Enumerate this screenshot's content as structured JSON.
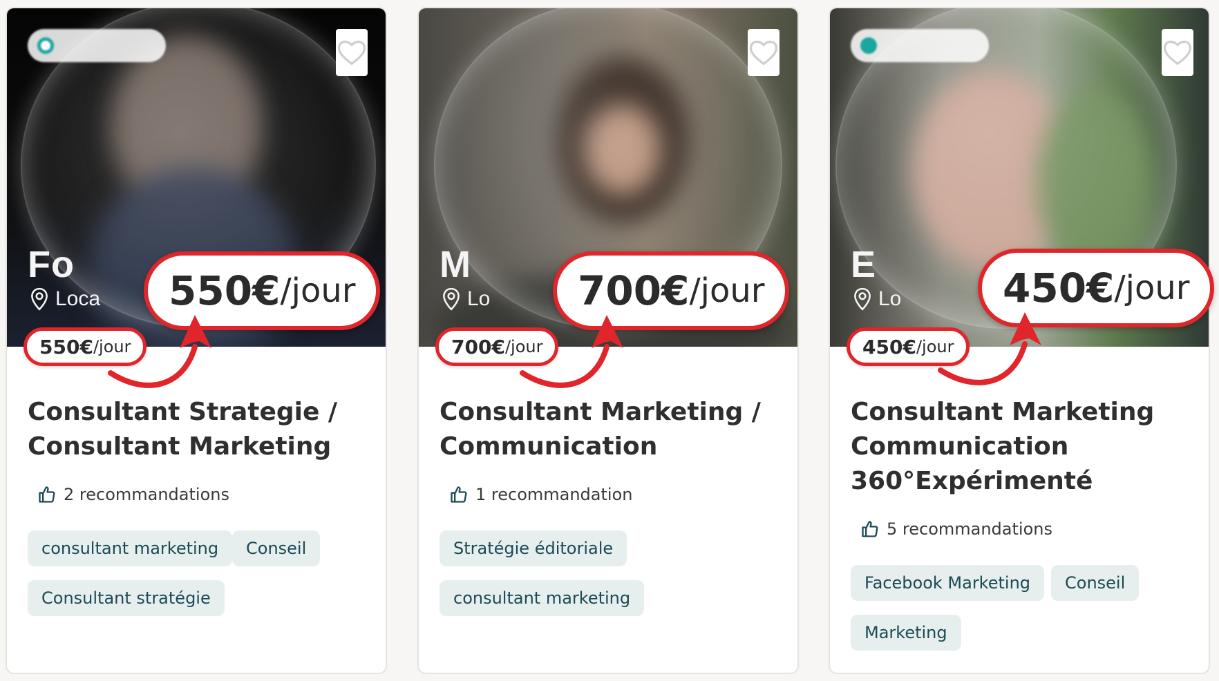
{
  "cards": [
    {
      "name_initial": "Fo",
      "location_prefix": "Loca",
      "status_dot_color": "#1ba6a0",
      "price_amount": "550€",
      "price_unit": "/jour",
      "title_lines": [
        "Consultant Strategie /",
        "Consultant Marketing"
      ],
      "recommendations": "2 recommandations",
      "tags": [
        "consultant marketing",
        "Conseil",
        "Consultant stratégie"
      ]
    },
    {
      "name_initial": "M",
      "location_prefix": "Lo",
      "price_amount": "700€",
      "price_unit": "/jour",
      "title_lines": [
        "Consultant Marketing /",
        "Communication"
      ],
      "recommendations": "1 recommandation",
      "tags": [
        "Stratégie éditoriale",
        "consultant marketing"
      ]
    },
    {
      "name_initial": "E",
      "location_prefix": "Lo",
      "status_dot_color": "#1ba6a0",
      "price_amount": "450€",
      "price_unit": "/jour",
      "title_lines": [
        "Consultant Marketing",
        "Communication",
        "360°Expérimenté"
      ],
      "recommendations": "5 recommandations",
      "tags": [
        "Facebook Marketing",
        "Conseil",
        "Marketing"
      ]
    }
  ],
  "colors": {
    "accent_red": "#e0252b",
    "tag_bg": "#e6eeee",
    "tag_text": "#1c4a55",
    "teal": "#1ba6a0"
  },
  "icons": [
    "heart-icon",
    "location-pin-icon",
    "thumbs-up-icon",
    "curved-arrow"
  ]
}
